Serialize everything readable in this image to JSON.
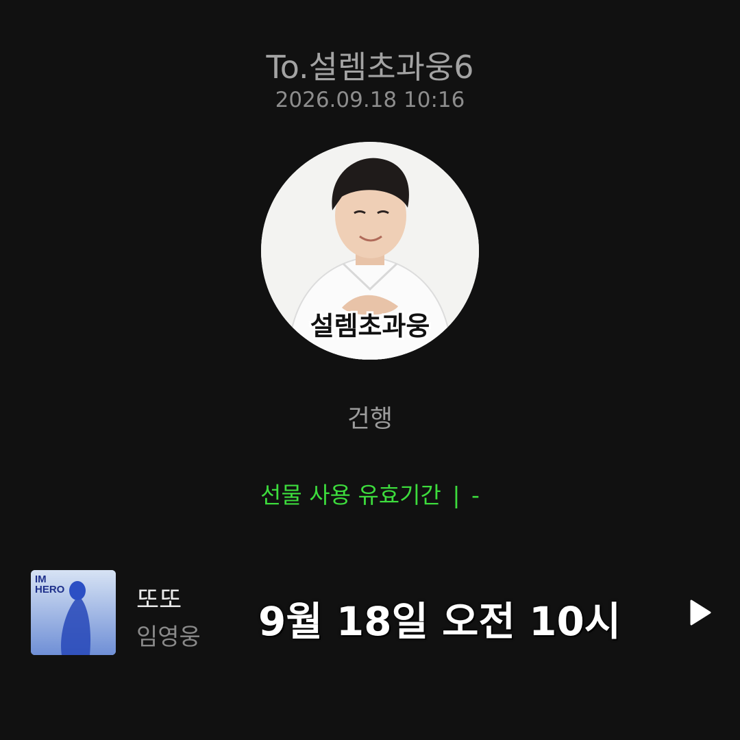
{
  "header": {
    "recipient": "To.설렘초과웅6",
    "timestamp": "2026.09.18 10:16"
  },
  "avatar": {
    "caption": "설렘초과웅"
  },
  "gift": {
    "name": "건행"
  },
  "validity": {
    "label": "선물 사용 유효기간",
    "separator": "|",
    "value": "-",
    "color": "#3ddc3d"
  },
  "music": {
    "title": "또또",
    "artist": "임영웅",
    "album_art_text": "IM HERO",
    "play_icon": "play-icon"
  },
  "overlay": {
    "text": "9월 18일 오전 10시"
  }
}
